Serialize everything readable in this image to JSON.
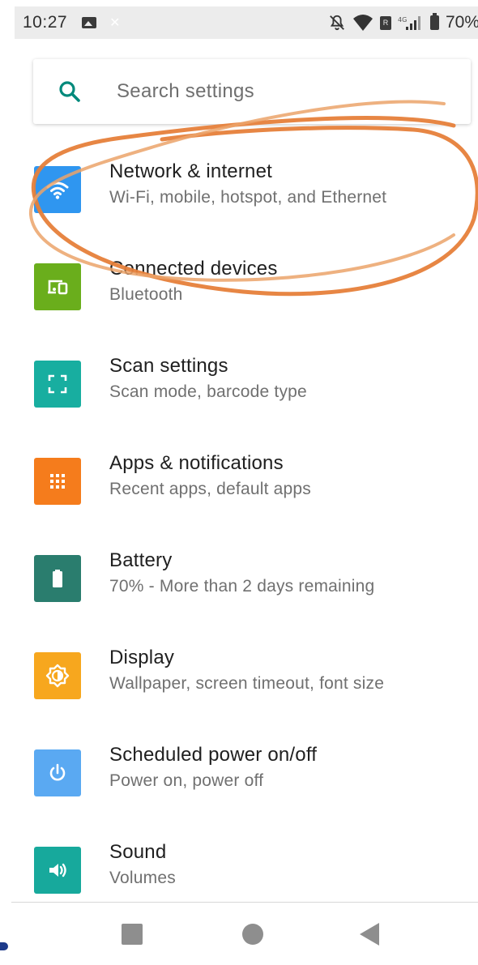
{
  "status_bar": {
    "time": "10:27",
    "battery_text": "70%",
    "icons": [
      "image-icon",
      "close-icon",
      "mute-icon",
      "wifi-icon",
      "sim-icon",
      "signal-icon",
      "battery-icon"
    ]
  },
  "search": {
    "placeholder": "Search settings",
    "icon": "search-icon"
  },
  "settings": [
    {
      "title": "Network & internet",
      "subtitle": "Wi-Fi, mobile, hotspot, and Ethernet",
      "icon": "wifi-icon",
      "color": "#2f96f0"
    },
    {
      "title": "Connected devices",
      "subtitle": "Bluetooth",
      "icon": "devices-icon",
      "color": "#6aae1c"
    },
    {
      "title": "Scan settings",
      "subtitle": "Scan mode, barcode type",
      "icon": "scan-icon",
      "color": "#18aea0"
    },
    {
      "title": "Apps & notifications",
      "subtitle": "Recent apps, default apps",
      "icon": "apps-icon",
      "color": "#f57c1c"
    },
    {
      "title": "Battery",
      "subtitle": "70% - More than 2 days remaining",
      "icon": "battery-icon",
      "color": "#2a7d6e"
    },
    {
      "title": "Display",
      "subtitle": "Wallpaper, screen timeout, font size",
      "icon": "brightness-icon",
      "color": "#f7a71e"
    },
    {
      "title": "Scheduled power on/off",
      "subtitle": "Power on, power off",
      "icon": "power-icon",
      "color": "#5aa9f2"
    },
    {
      "title": "Sound",
      "subtitle": "Volumes",
      "icon": "volume-icon",
      "color": "#17a99c"
    }
  ],
  "annotation": {
    "color": "#e6803a",
    "highlighted_item": "Network & internet"
  },
  "nav_bar": {
    "buttons": [
      "recents-button",
      "home-button",
      "back-button"
    ],
    "color": "#8e8e8e"
  }
}
